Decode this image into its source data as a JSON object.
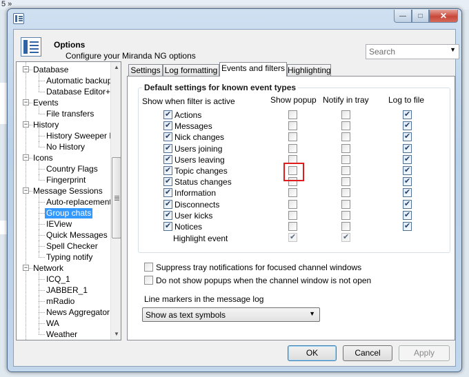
{
  "background": {
    "top_text": "5 »"
  },
  "window": {
    "controls": {
      "minimize": "—",
      "maximize": "□",
      "close": "✕"
    },
    "header_title": "Options",
    "header_subtitle": "Configure your Miranda NG options",
    "search_placeholder": "Search"
  },
  "tree": [
    {
      "label": "Database",
      "level": 0,
      "expanded": true
    },
    {
      "label": "Automatic backups",
      "level": 1
    },
    {
      "label": "Database Editor++",
      "level": 1
    },
    {
      "label": "Events",
      "level": 0,
      "expanded": true
    },
    {
      "label": "File transfers",
      "level": 1
    },
    {
      "label": "History",
      "level": 0,
      "expanded": true
    },
    {
      "label": "History Sweeper Li",
      "level": 1
    },
    {
      "label": "No History",
      "level": 1
    },
    {
      "label": "Icons",
      "level": 0,
      "expanded": true
    },
    {
      "label": "Country Flags",
      "level": 1
    },
    {
      "label": "Fingerprint",
      "level": 1
    },
    {
      "label": "Message Sessions",
      "level": 0,
      "expanded": true
    },
    {
      "label": "Auto-replacements",
      "level": 1
    },
    {
      "label": "Group chats",
      "level": 1,
      "selected": true
    },
    {
      "label": "IEView",
      "level": 1
    },
    {
      "label": "Quick Messages",
      "level": 1
    },
    {
      "label": "Spell Checker",
      "level": 1
    },
    {
      "label": "Typing notify",
      "level": 1
    },
    {
      "label": "Network",
      "level": 0,
      "expanded": true
    },
    {
      "label": "ICQ_1",
      "level": 1
    },
    {
      "label": "JABBER_1",
      "level": 1
    },
    {
      "label": "mRadio",
      "level": 1
    },
    {
      "label": "News Aggregator",
      "level": 1
    },
    {
      "label": "WA",
      "level": 1
    },
    {
      "label": "Weather",
      "level": 1
    }
  ],
  "tabs": [
    {
      "label": "Settings",
      "active": false
    },
    {
      "label": "Log formatting",
      "active": false
    },
    {
      "label": "Events and filters",
      "active": true
    },
    {
      "label": "Highlighting",
      "active": false
    }
  ],
  "group": {
    "title": "Default settings for known event types",
    "columns": [
      "Show when filter is active",
      "Show popup",
      "Notify in tray",
      "Log to file"
    ],
    "rows": [
      {
        "label": "Actions",
        "filter": true,
        "popup": false,
        "tray": false,
        "log": true
      },
      {
        "label": "Messages",
        "filter": true,
        "popup": false,
        "tray": false,
        "log": true
      },
      {
        "label": "Nick changes",
        "filter": true,
        "popup": false,
        "tray": false,
        "log": true
      },
      {
        "label": "Users joining",
        "filter": true,
        "popup": false,
        "tray": false,
        "log": true
      },
      {
        "label": "Users leaving",
        "filter": true,
        "popup": false,
        "tray": false,
        "log": true
      },
      {
        "label": "Topic changes",
        "filter": true,
        "popup": false,
        "tray": false,
        "log": true
      },
      {
        "label": "Status changes",
        "filter": true,
        "popup": false,
        "tray": false,
        "log": true
      },
      {
        "label": "Information",
        "filter": true,
        "popup": false,
        "tray": false,
        "log": true
      },
      {
        "label": "Disconnects",
        "filter": true,
        "popup": false,
        "tray": false,
        "log": true
      },
      {
        "label": "User kicks",
        "filter": true,
        "popup": false,
        "tray": false,
        "log": true
      },
      {
        "label": "Notices",
        "filter": true,
        "popup": false,
        "tray": false,
        "log": true
      }
    ],
    "highlight_row": {
      "label": "Highlight event",
      "popup": true,
      "tray": true
    }
  },
  "options": [
    {
      "label": "Suppress tray notifications for focused channel windows",
      "checked": false
    },
    {
      "label": "Do not show popups when the channel window is not open",
      "checked": false
    }
  ],
  "line_markers": {
    "label": "Line markers in the message log",
    "value": "Show as text symbols"
  },
  "buttons": {
    "ok": "OK",
    "cancel": "Cancel",
    "apply": "Apply"
  }
}
